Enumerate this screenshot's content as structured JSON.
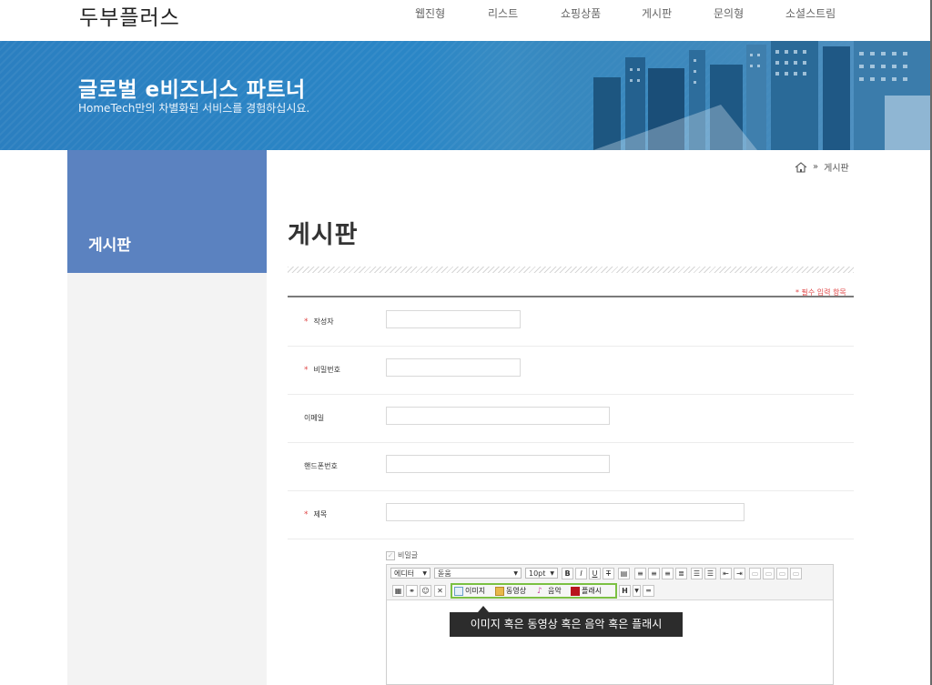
{
  "header": {
    "logo": "두부플러스",
    "nav": [
      "웹진형",
      "리스트",
      "쇼핑상품",
      "게시판",
      "문의형",
      "소셜스트림"
    ]
  },
  "banner": {
    "title": "글로벌 e비즈니스 파트너",
    "subtitle": "HomeTech만의 차별화된 서비스를 경험하십시요."
  },
  "sidebar": {
    "title": "게시판"
  },
  "breadcrumb": {
    "separator": "»",
    "current": "게시판",
    "home_icon": "home-icon"
  },
  "main": {
    "title": "게시판",
    "required_note": "* 필수 입력 항목"
  },
  "form": {
    "fields": [
      {
        "label": "작성자",
        "required": true
      },
      {
        "label": "비밀번호",
        "required": true
      },
      {
        "label": "이메일",
        "required": false
      },
      {
        "label": "핸드폰번호",
        "required": false
      },
      {
        "label": "제목",
        "required": true
      }
    ],
    "required_star": "*",
    "secret_label": "비밀글"
  },
  "editor": {
    "mode_select": "에디터",
    "font_select": "돋움",
    "size_select": "10pt",
    "buttons": {
      "bold": "B",
      "italic": "I",
      "underline": "U",
      "strike": "T",
      "heading": "H"
    },
    "media": {
      "image": "이미지",
      "video": "동영상",
      "music": "음악",
      "flash": "플래시"
    },
    "tooltip": "이미지 혹은 동영상 혹은 음악 혹은 플래시"
  },
  "colors": {
    "sidebar_accent": "#5b82c0",
    "required": "#e04848",
    "highlight": "#7bc043",
    "banner": "#2a86c6"
  }
}
